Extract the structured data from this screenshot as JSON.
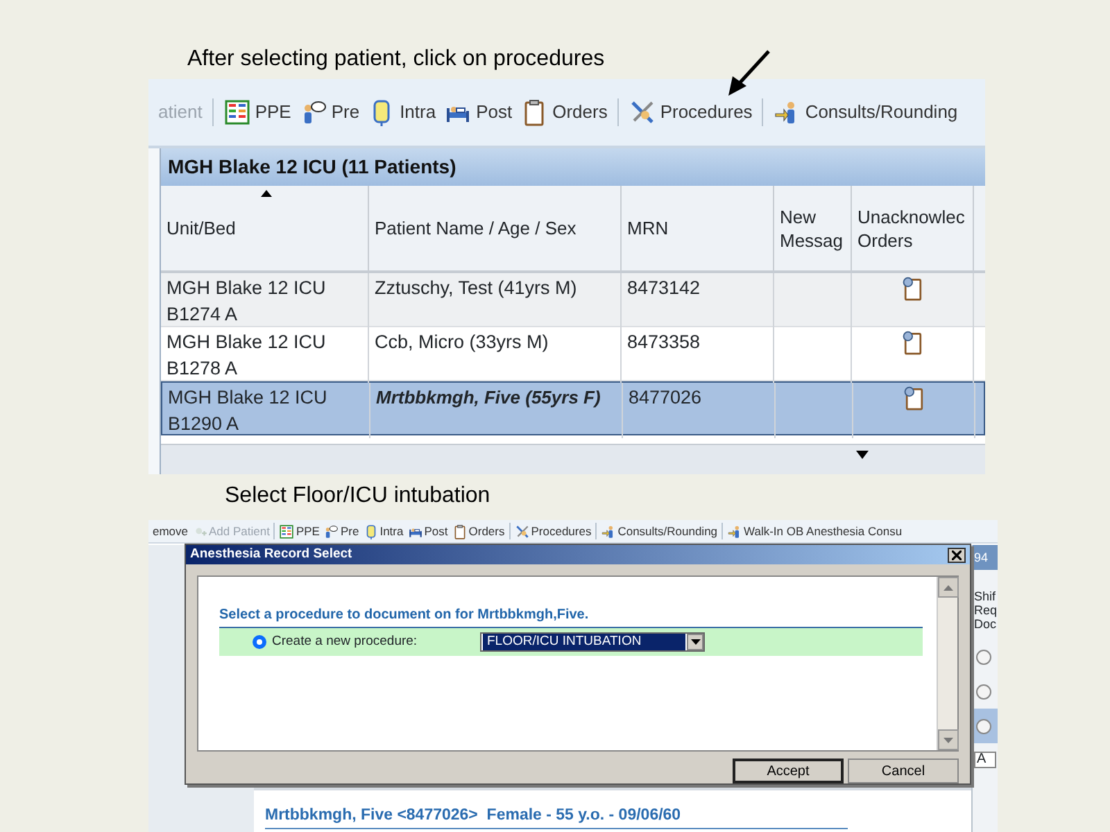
{
  "step_1": {
    "caption": "After selecting patient, click on procedures",
    "toolbar": [
      {
        "items": [
          {
            "label": "atient",
            "kind": "none",
            "disabled": true
          }
        ]
      },
      {
        "items": [
          {
            "label": "PPE",
            "kind": "ppe",
            "disabled": false
          },
          {
            "label": "Pre",
            "kind": "pre",
            "disabled": false
          },
          {
            "label": "Intra",
            "kind": "intra",
            "disabled": false
          },
          {
            "label": "Post",
            "kind": "post",
            "disabled": false
          },
          {
            "label": "Orders",
            "kind": "orders",
            "disabled": false
          }
        ]
      },
      {
        "items": [
          {
            "label": "Procedures",
            "kind": "procedures",
            "disabled": false
          }
        ]
      },
      {
        "items": [
          {
            "label": "Consults/Rounding",
            "kind": "consults",
            "disabled": false
          }
        ]
      }
    ],
    "grid": {
      "title": "MGH Blake 12 ICU (11 Patients)",
      "columns": [
        {
          "lines": [
            "Unit/Bed"
          ],
          "sorted": true
        },
        {
          "lines": [
            "Patient Name / Age / Sex"
          ],
          "sorted": false
        },
        {
          "lines": [
            "MRN"
          ],
          "sorted": false
        },
        {
          "lines": [
            "New",
            "Messag"
          ],
          "sorted": false
        },
        {
          "lines": [
            "Unacknowlec",
            "Orders"
          ],
          "sorted": false
        }
      ],
      "rows": [
        {
          "unit_bed": "MGH Blake 12 ICU B1274 A",
          "patient": "Zztuschy, Test (41yrs M)",
          "mrn": "8473142",
          "selected": false,
          "bold": false
        },
        {
          "unit_bed": "MGH Blake 12 ICU B1278 A",
          "patient": "Ccb, Micro (33yrs M)",
          "mrn": "8473358",
          "selected": false,
          "bold": false
        },
        {
          "unit_bed": "MGH Blake 12 ICU B1290 A",
          "patient": "Mrtbbkmgh, Five (55yrs F)",
          "mrn": "8477026",
          "selected": true,
          "bold": true
        }
      ]
    }
  },
  "step_2": {
    "caption": "Select Floor/ICU intubation",
    "toolbar": [
      {
        "items": [
          {
            "label": "emove",
            "kind": "none",
            "disabled": false
          },
          {
            "label": "Add Patient",
            "kind": "add",
            "disabled": true
          }
        ]
      },
      {
        "items": [
          {
            "label": "PPE",
            "kind": "ppe",
            "disabled": false
          },
          {
            "label": "Pre",
            "kind": "pre",
            "disabled": false
          },
          {
            "label": "Intra",
            "kind": "intra",
            "disabled": false
          },
          {
            "label": "Post",
            "kind": "post",
            "disabled": false
          },
          {
            "label": "Orders",
            "kind": "orders",
            "disabled": false
          }
        ]
      },
      {
        "items": [
          {
            "label": "Procedures",
            "kind": "procedures",
            "disabled": false
          }
        ]
      },
      {
        "items": [
          {
            "label": "Consults/Rounding",
            "kind": "consults",
            "disabled": false
          }
        ]
      },
      {
        "items": [
          {
            "label": "Walk-In OB Anesthesia Consu",
            "kind": "consults",
            "disabled": false
          }
        ]
      }
    ],
    "dialog": {
      "title": "Anesthesia Record Select",
      "instruction": "Select a procedure to document on for Mrtbbkmgh,Five.",
      "option": {
        "label": "Create a new procedure:",
        "selected": true
      },
      "procedure": "FLOOR/ICU INTUBATION",
      "buttons": [
        {
          "label": "Accept",
          "default": true
        },
        {
          "label": "Cancel",
          "default": false
        }
      ]
    },
    "background": {
      "side_texts": [
        "94",
        "Shif",
        "Req",
        "Doc"
      ],
      "side_rows": [
        {
          "selected": false
        },
        {
          "selected": false
        },
        {
          "selected": true
        }
      ],
      "side_field": "A",
      "patient_banner": "Mrtbbkmgh, Five <8477026>  Female - 55 y.o. - 09/06/60"
    }
  }
}
